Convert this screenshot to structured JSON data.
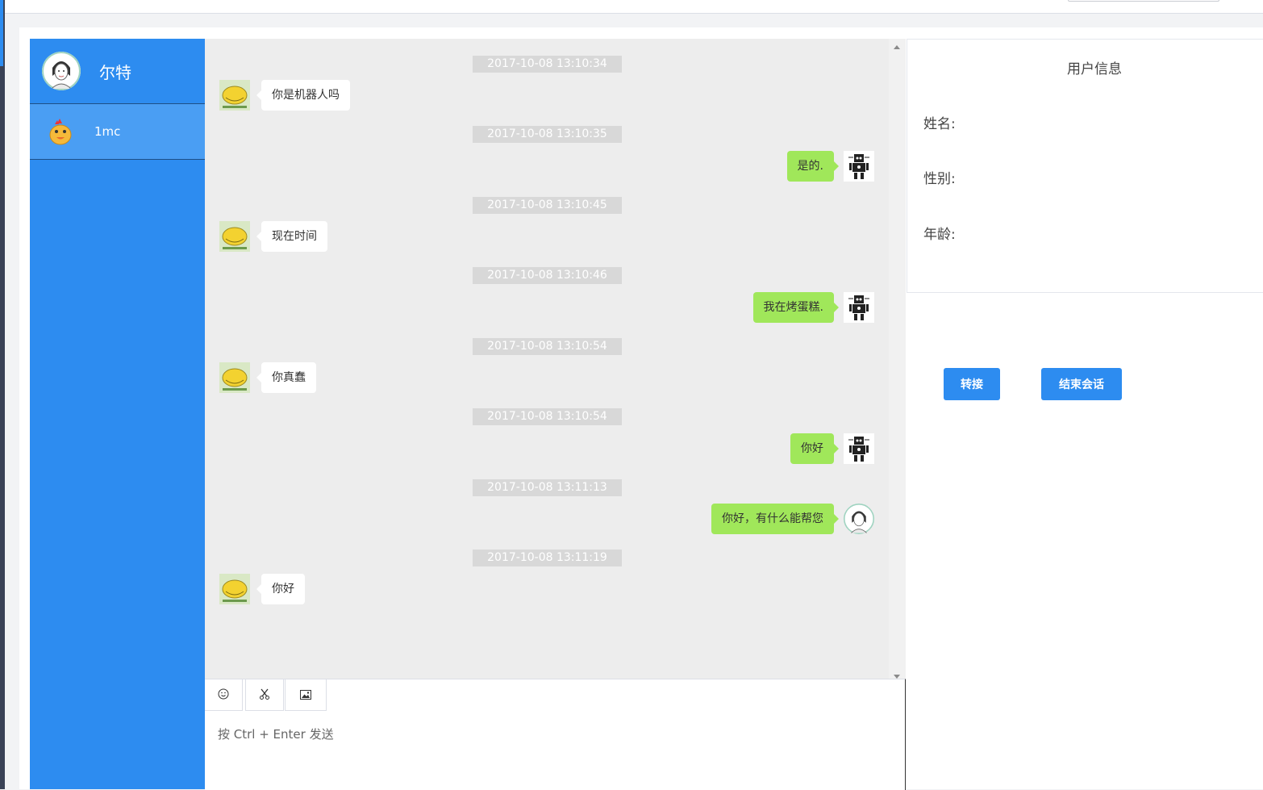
{
  "app": {
    "brand_color": "#2d8cf0"
  },
  "sidebar": {
    "agent": {
      "name": "尔特",
      "avatar_icon": "woman-portrait-icon"
    },
    "sessions": [
      {
        "name": "1mc",
        "icon": "chick-avatar-icon"
      }
    ]
  },
  "chat": {
    "timestamps": [
      "2017-10-08 13:10:34",
      "2017-10-08 13:10:35",
      "2017-10-08 13:10:45",
      "2017-10-08 13:10:46",
      "2017-10-08 13:10:54",
      "2017-10-08 13:10:54",
      "2017-10-08 13:11:13",
      "2017-10-08 13:11:19"
    ],
    "messages": [
      {
        "side": "left",
        "sender": "customer",
        "text": "你是机器人吗"
      },
      {
        "side": "right",
        "sender": "robot",
        "text": "是的."
      },
      {
        "side": "left",
        "sender": "customer",
        "text": "现在时间"
      },
      {
        "side": "right",
        "sender": "robot",
        "text": "我在烤蛋糕."
      },
      {
        "side": "left",
        "sender": "customer",
        "text": "你真蠢"
      },
      {
        "side": "right",
        "sender": "robot",
        "text": "你好"
      },
      {
        "side": "right",
        "sender": "agent",
        "text": "你好，有什么能帮您"
      },
      {
        "side": "left",
        "sender": "customer",
        "text": "你好"
      }
    ],
    "bubble_colors": {
      "incoming": "#ffffff",
      "outgoing": "#a0e75a"
    }
  },
  "composer": {
    "tools": [
      "emoji-icon",
      "scissors-icon",
      "image-icon"
    ],
    "placeholder": "按 Ctrl + Enter 发送"
  },
  "user_info": {
    "title": "用户信息",
    "name_label": "姓名:",
    "gender_label": "性别:",
    "age_label": "年龄:"
  },
  "actions": {
    "transfer_label": "转接",
    "end_label": "结束会话"
  }
}
